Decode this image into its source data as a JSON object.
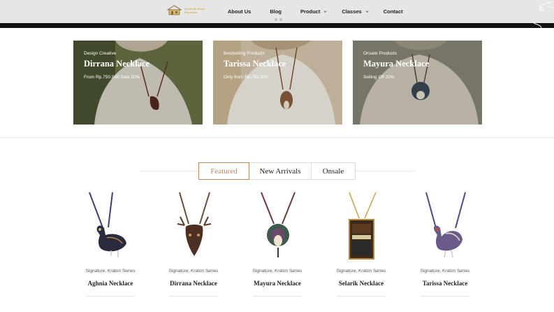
{
  "header": {
    "logo_alt": "Jewelry & Artisan Kawinjawa",
    "logo_line1": "Jewelry & Artisan",
    "logo_line2": "Kawinjawa",
    "nav": [
      {
        "label": "About Us",
        "has_dropdown": false
      },
      {
        "label": "Blog",
        "has_dropdown": false
      },
      {
        "label": "Product",
        "has_dropdown": true
      },
      {
        "label": "Classes",
        "has_dropdown": true
      },
      {
        "label": "Contact",
        "has_dropdown": false
      }
    ]
  },
  "promos": [
    {
      "eyebrow": "Design Creative",
      "title": "Dirrana Necklace",
      "subtitle": "From Rp.750.000 Sale 20%"
    },
    {
      "eyebrow": "Bestselling Products",
      "title": "Tarissa Necklace",
      "subtitle": "Only from Rp.750.000"
    },
    {
      "eyebrow": "Onsale Products",
      "title": "Mayura Necklace",
      "subtitle": "Selling Off 20%"
    }
  ],
  "tabs": [
    {
      "label": "Featured",
      "active": true
    },
    {
      "label": "New Arrivals",
      "active": false
    },
    {
      "label": "Onsale",
      "active": false
    }
  ],
  "products": [
    {
      "series": "Signature, Kraton Series",
      "name": "Aghnia Necklace",
      "icon": "peacock-bird-pendant-icon"
    },
    {
      "series": "Signature, Kraton Series",
      "name": "Dirrana Necklace",
      "icon": "deer-antler-pendant-icon"
    },
    {
      "series": "Signature, Kraton Series",
      "name": "Mayura Necklace",
      "icon": "peacock-tail-pendant-icon"
    },
    {
      "series": "Signature, Kraton Series",
      "name": "Selarik Necklace",
      "icon": "rectangular-beaded-pendant-icon"
    },
    {
      "series": "Signature, Kraton Series",
      "name": "Tarissa Necklace",
      "icon": "rooster-pendant-icon"
    }
  ],
  "colors": {
    "header_bg": "#e6e6e6",
    "logo_gold": "#c99a2e",
    "tab_active": "#b88a64",
    "text_dark": "#222222"
  }
}
